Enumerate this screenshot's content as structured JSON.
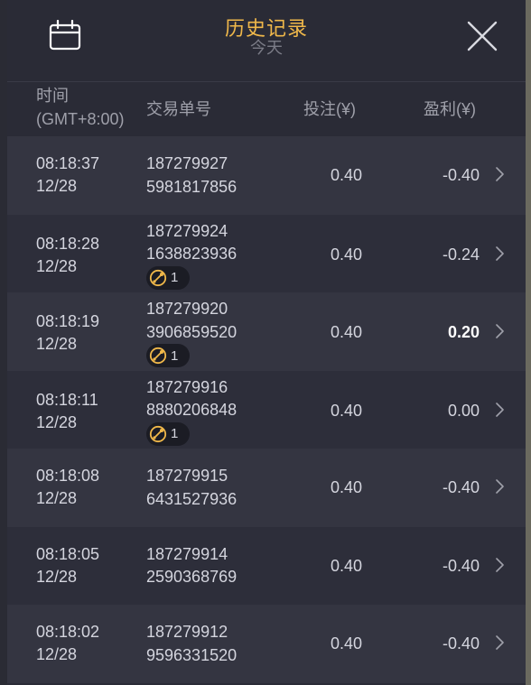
{
  "header": {
    "title": "历史记录",
    "subtitle": "今天",
    "calendar_icon": "calendar-icon",
    "close_icon": "close-icon"
  },
  "columns": {
    "time_line1": "时间",
    "time_line2": "(GMT+8:00)",
    "order": "交易单号",
    "bet": "投注(¥)",
    "profit": "盈利(¥)"
  },
  "colors": {
    "accent": "#f0b84a",
    "badge_icon": "#f0b84a",
    "row_odd": "#343541",
    "row_even": "#2d2e3a"
  },
  "rows": [
    {
      "time": "08:18:37",
      "date": "12/28",
      "order1": "187279927",
      "order2": "5981817856",
      "bet": "0.40",
      "profit": "-0.40",
      "badge": ""
    },
    {
      "time": "08:18:28",
      "date": "12/28",
      "order1": "187279924",
      "order2": "1638823936",
      "bet": "0.40",
      "profit": "-0.24",
      "badge": "1"
    },
    {
      "time": "08:18:19",
      "date": "12/28",
      "order1": "187279920",
      "order2": "3906859520",
      "bet": "0.40",
      "profit": "0.20",
      "badge": "1"
    },
    {
      "time": "08:18:11",
      "date": "12/28",
      "order1": "187279916",
      "order2": "8880206848",
      "bet": "0.40",
      "profit": "0.00",
      "badge": "1"
    },
    {
      "time": "08:18:08",
      "date": "12/28",
      "order1": "187279915",
      "order2": "6431527936",
      "bet": "0.40",
      "profit": "-0.40",
      "badge": ""
    },
    {
      "time": "08:18:05",
      "date": "12/28",
      "order1": "187279914",
      "order2": "2590368769",
      "bet": "0.40",
      "profit": "-0.40",
      "badge": ""
    },
    {
      "time": "08:18:02",
      "date": "12/28",
      "order1": "187279912",
      "order2": "9596331520",
      "bet": "0.40",
      "profit": "-0.40",
      "badge": ""
    }
  ]
}
